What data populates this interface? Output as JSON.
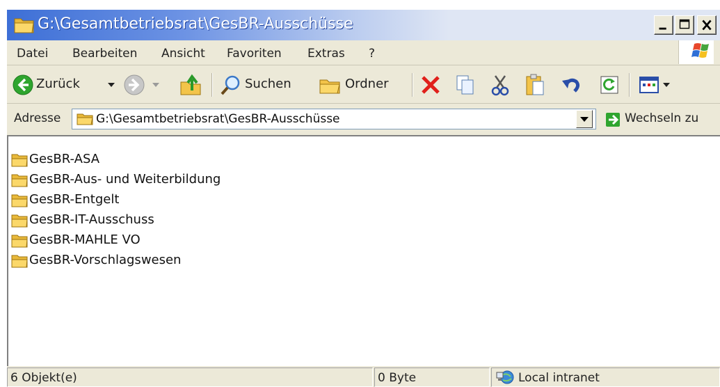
{
  "window": {
    "title": "G:\\Gesamtbetriebsrat\\GesBR-Ausschüsse"
  },
  "menu": [
    "Datei",
    "Bearbeiten",
    "Ansicht",
    "Favoriten",
    "Extras",
    "?"
  ],
  "toolbar": {
    "back_label": "Zurück",
    "search_label": "Suchen",
    "folders_label": "Ordner"
  },
  "address": {
    "label": "Adresse",
    "value": "G:\\Gesamtbetriebsrat\\GesBR-Ausschüsse",
    "go_label": "Wechseln zu"
  },
  "files": [
    "GesBR-ASA",
    "GesBR-Aus- und Weiterbildung",
    "GesBR-Entgelt",
    "GesBR-IT-Ausschuss",
    "GesBR-MAHLE VO",
    "GesBR-Vorschlagswesen"
  ],
  "status": {
    "objects": "6 Objekt(e)",
    "size": "0 Byte",
    "zone": "Local intranet"
  },
  "icons": {
    "title": "folder-icon",
    "back": "back-arrow-icon",
    "forward": "forward-arrow-icon",
    "up": "folder-up-icon",
    "search": "search-icon",
    "folders": "folders-icon",
    "delete": "delete-icon",
    "copy_to": "copy-icon",
    "cut": "cut-icon",
    "paste": "paste-icon",
    "undo": "undo-icon",
    "refresh": "refresh-icon",
    "views": "views-icon",
    "go": "go-arrow-icon",
    "zone": "intranet-icon"
  },
  "colors": {
    "titlebar_start": "#3d6fd6",
    "back_green": "#2fa52f",
    "delete_red": "#e0201b",
    "folder_yellow": "#f3c44a"
  }
}
